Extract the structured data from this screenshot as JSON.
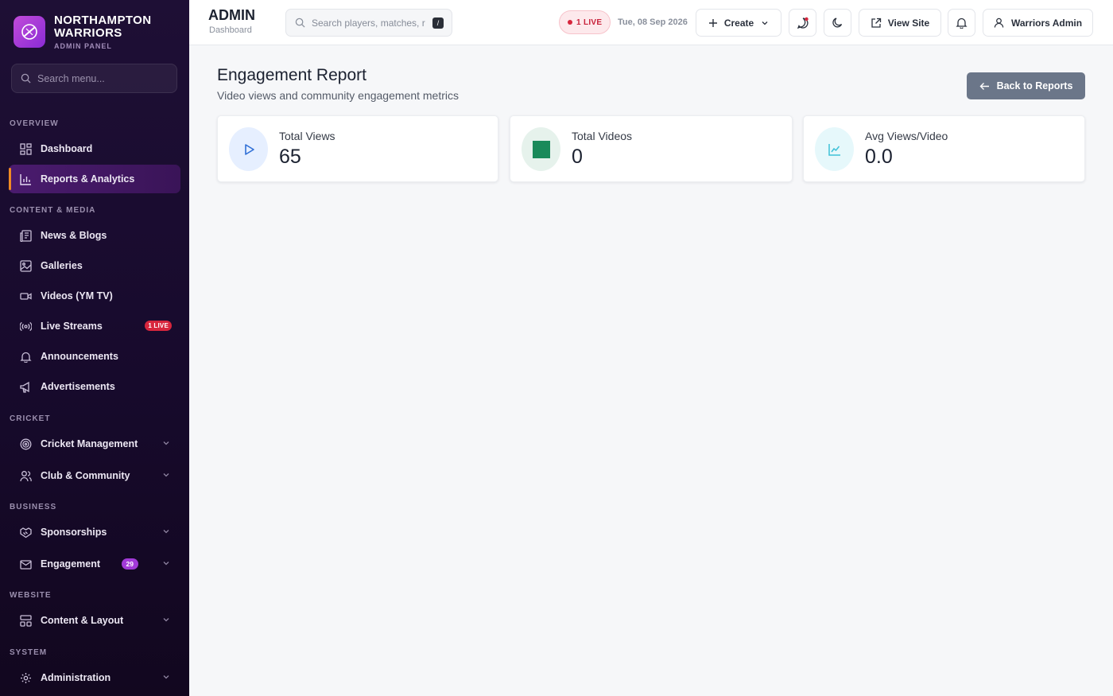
{
  "brand": {
    "name_line1": "NORTHAMPTON",
    "name_line2": "WARRIORS",
    "sub": "ADMIN PANEL"
  },
  "sidebar": {
    "search_placeholder": "Search menu...",
    "sections": {
      "overview": "OVERVIEW",
      "content": "CONTENT & MEDIA",
      "cricket": "CRICKET",
      "business": "BUSINESS",
      "website": "WEBSITE",
      "system": "SYSTEM"
    },
    "items": {
      "dashboard": "Dashboard",
      "reports": "Reports & Analytics",
      "news": "News & Blogs",
      "galleries": "Galleries",
      "videos": "Videos (YM TV)",
      "live": "Live Streams",
      "live_badge": "1 LIVE",
      "announcements": "Announcements",
      "advertisements": "Advertisements",
      "cricket_mgmt": "Cricket Management",
      "club": "Club & Community",
      "sponsorships": "Sponsorships",
      "engagement": "Engagement",
      "engagement_badge": "29",
      "content_layout": "Content & Layout",
      "administration": "Administration"
    },
    "active_item": "reports"
  },
  "header": {
    "title": "ADMIN",
    "subtitle": "Dashboard",
    "search_placeholder": "Search players, matches, r",
    "search_shortcut": "/",
    "live_label": "1 LIVE",
    "date": "Tue, 08 Sep 2026",
    "create_label": "Create",
    "view_site_label": "View Site",
    "user_label": "Warriors Admin"
  },
  "page": {
    "title": "Engagement Report",
    "description": "Video views and community engagement metrics",
    "back_label": "Back to Reports",
    "stats": [
      {
        "label": "Total Views",
        "value": "65",
        "icon": "play-icon"
      },
      {
        "label": "Total Videos",
        "value": "0",
        "icon": "square-icon"
      },
      {
        "label": "Avg Views/Video",
        "value": "0.0",
        "icon": "line-chart-icon"
      }
    ]
  },
  "colors": {
    "sidebar_bg": "#1e0f35",
    "accent_purple": "#a23ad8",
    "active_marker": "#f08a24",
    "live_red": "#d7263d",
    "back_button": "#6b7689",
    "views_icon": "#2f6fd6",
    "videos_icon": "#1a8a5a",
    "avg_icon": "#3ec1d8"
  }
}
